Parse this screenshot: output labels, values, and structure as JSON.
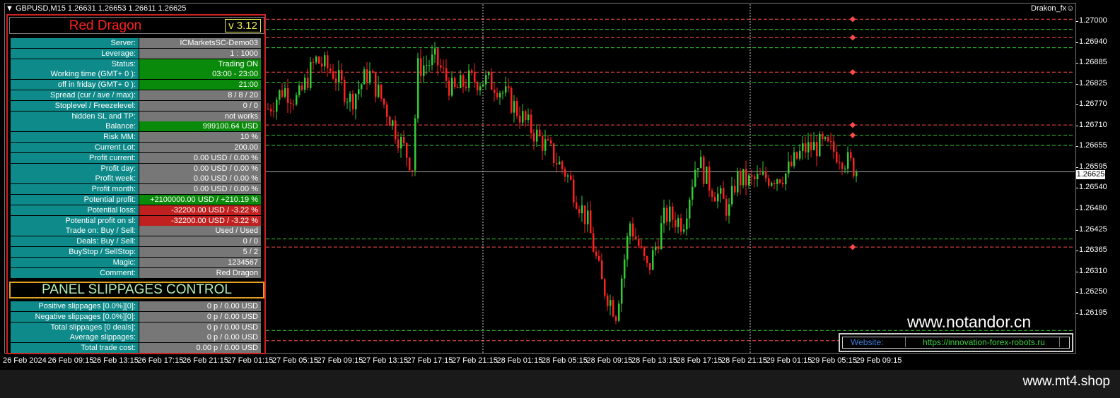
{
  "chart": {
    "symbol": "GBPUSD,M15  1.26631 1.26653 1.26611 1.26625",
    "indicator": "Drakon_fx",
    "current_price": "1.26625",
    "price_ticks": [
      "1.27000",
      "1.26940",
      "1.26885",
      "1.26825",
      "1.26770",
      "1.26710",
      "1.26655",
      "1.26595",
      "1.26540",
      "1.26480",
      "1.26425",
      "1.26365",
      "1.26310",
      "1.26250",
      "1.26195"
    ],
    "time_ticks": [
      "26 Feb 2024",
      "26 Feb 09:15",
      "26 Feb 13:15",
      "26 Feb 17:15",
      "26 Feb 21:15",
      "27 Feb 01:15",
      "27 Feb 05:15",
      "27 Feb 09:15",
      "27 Feb 13:15",
      "27 Feb 17:15",
      "27 Feb 21:15",
      "28 Feb 01:15",
      "28 Feb 05:15",
      "28 Feb 09:15",
      "28 Feb 13:15",
      "28 Feb 17:15",
      "28 Feb 21:15",
      "29 Feb 01:15",
      "29 Feb 05:15",
      "29 Feb 09:15"
    ],
    "colors": {
      "bull": "#33cc33",
      "bear": "#ff2020",
      "red_line": "#ff4a4a",
      "green_line": "#33cc33"
    }
  },
  "panel": {
    "title": "Red Dragon",
    "version": "v 3.12",
    "rows": [
      {
        "label": "Server:",
        "value": "ICMarketsSC-Demo03",
        "style": ""
      },
      {
        "label": "Leverage:",
        "value": "1 : 1000",
        "style": ""
      },
      {
        "label": "Status:",
        "value": "Trading ON",
        "style": "green"
      },
      {
        "label": "Working time (GMT+ 0 ):",
        "value": "03:00 - 23:00",
        "style": "green"
      },
      {
        "label": "off in friday (GMT+ 0 ):",
        "value": "21:00",
        "style": "green"
      },
      {
        "label": "Spread (cur / ave / max):",
        "value": "8 / 8 / 20",
        "style": ""
      },
      {
        "label": "Stoplevel  /  Freezelevel:",
        "value": "0  /  0",
        "style": ""
      },
      {
        "label": "hidden SL and TP:",
        "value": "not works",
        "style": ""
      },
      {
        "label": "Balance:",
        "value": "999100.64 USD",
        "style": "green"
      },
      {
        "label": "Risk MM:",
        "value": "10 %",
        "style": ""
      },
      {
        "label": "Current Lot:",
        "value": "200.00",
        "style": ""
      },
      {
        "label": "Profit current:",
        "value": "0.00 USD / 0.00 %",
        "style": ""
      },
      {
        "label": "Profit day:",
        "value": "0.00 USD / 0.00 %",
        "style": ""
      },
      {
        "label": "Profit week:",
        "value": "0.00 USD / 0.00 %",
        "style": ""
      },
      {
        "label": "Profit month:",
        "value": "0.00 USD / 0.00 %",
        "style": ""
      },
      {
        "label": "Potential profit:",
        "value": "+2100000.00 USD / +210.19 %",
        "style": "green"
      },
      {
        "label": "Potential loss:",
        "value": "-32200.00 USD / -3.22 %",
        "style": "red"
      },
      {
        "label": "Potential profit on sl:",
        "value": "-32200.00 USD / -3.22 %",
        "style": "red"
      },
      {
        "label": "Trade on: Buy  /  Sell:",
        "value": "Used  /  Used",
        "style": ""
      },
      {
        "label": "Deals: Buy / Sell:",
        "value": "0  /  0",
        "style": ""
      },
      {
        "label": "BuyStop / SellStop:",
        "value": "5  /  2",
        "style": ""
      },
      {
        "label": "Magic:",
        "value": "1234567",
        "style": ""
      },
      {
        "label": "Comment:",
        "value": "Red Dragon",
        "style": ""
      }
    ],
    "slippage_title": "PANEL SLIPPAGES CONTROL",
    "slippage_rows": [
      {
        "label": "Positive slippages [0.0%][0]:",
        "value": "0 p / 0.00 USD"
      },
      {
        "label": "Negative slippages [0.0%][0]:",
        "value": "0 p / 0.00 USD"
      },
      {
        "label": "Total slippages [0 deals]:",
        "value": "0 p / 0.00 USD"
      },
      {
        "label": "Average slippages:",
        "value": "0 p / 0.00 USD"
      },
      {
        "label": "Total trade cost:",
        "value": "0.00 p / 0.00 USD"
      }
    ]
  },
  "watermark": "www.notandor.cn",
  "website": {
    "label": "Website:",
    "url": "https://innovation-forex-robots.ru"
  },
  "footer": "www.mt4.shop"
}
